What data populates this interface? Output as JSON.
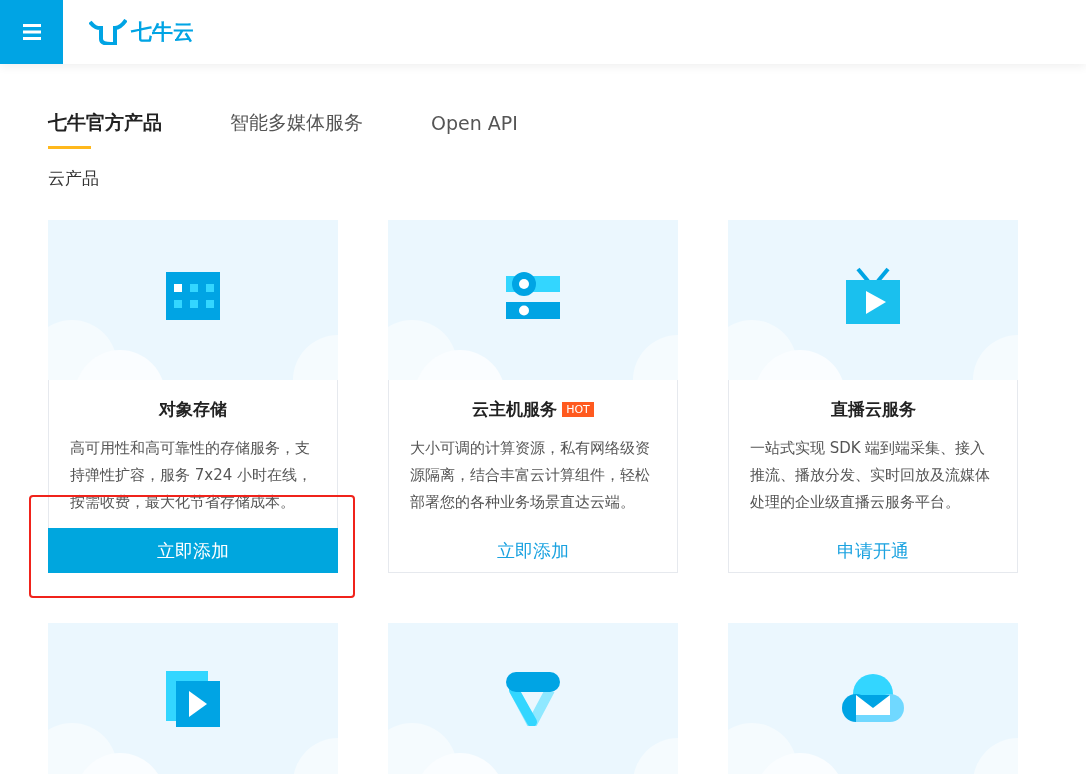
{
  "header": {
    "logo_text": "七牛云"
  },
  "tabs": [
    {
      "label": "七牛官方产品",
      "selected": true
    },
    {
      "label": "智能多媒体服务",
      "selected": false
    },
    {
      "label": "Open API",
      "selected": false
    }
  ],
  "section_title": "云产品",
  "cards": [
    {
      "title": "对象存储",
      "description": "高可用性和高可靠性的存储服务，支持弹性扩容，服务 7x24 小时在线，按需收费，最大化节省存储成本。",
      "action": "立即添加",
      "selected": true,
      "highlighted": true
    },
    {
      "title": "云主机服务",
      "badge": "HOT",
      "description": "大小可调的计算资源，私有网络级资源隔离，结合丰富云计算组件，轻松部署您的各种业务场景直达云端。",
      "action": "立即添加",
      "selected": false,
      "highlighted": false
    },
    {
      "title": "直播云服务",
      "description": "一站式实现 SDK 端到端采集、接入推流、播放分发、实时回放及流媒体处理的企业级直播云服务平台。",
      "action": "申请开通",
      "selected": false,
      "highlighted": false
    }
  ]
}
